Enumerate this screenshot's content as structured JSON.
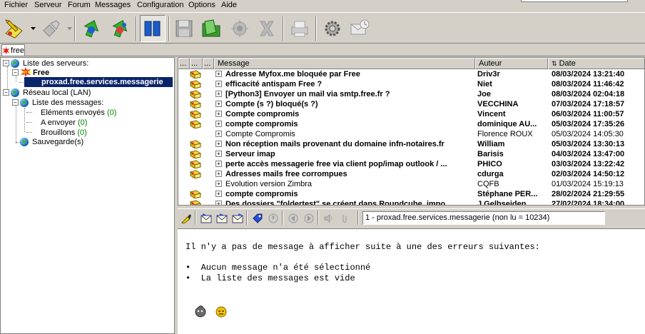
{
  "menu": {
    "fichier": "Fichier",
    "serveur": "Serveur",
    "forum": "Forum",
    "messages": "Messages",
    "configuration": "Configuration",
    "options": "Options",
    "aide": "Aide"
  },
  "account_tab": {
    "label": "free"
  },
  "tree": {
    "server_list": "Liste des serveurs:",
    "free": "Free",
    "mailbox": "proxad.free.services.messagerie",
    "lan": "Réseau local (LAN)",
    "message_list": "Liste des messages:",
    "sent": {
      "label": "Eléments envoyés",
      "count": "(0)"
    },
    "outbox": {
      "label": "A envoyer",
      "count": "(0)"
    },
    "drafts": {
      "label": "Brouillons",
      "count": "(0)"
    },
    "backup": "Sauvegarde(s)"
  },
  "list_header": {
    "col1": "...",
    "col2": "...",
    "col3": "...",
    "message": "Message",
    "author": "Auteur",
    "date": "Date"
  },
  "messages": [
    {
      "subject": "Adresse Myfox.me bloquée par Free",
      "author": "Driv3r",
      "date": "08/03/2024 13:21:40",
      "unread": true
    },
    {
      "subject": "efficacité antispam Free ?",
      "author": "Niet",
      "date": "08/03/2024 11:46:42",
      "unread": true
    },
    {
      "subject": "[Python3] Envoyer un mail via smtp.free.fr ?",
      "author": "Joe",
      "date": "08/03/2024 02:04:18",
      "unread": true
    },
    {
      "subject": "Compte (s ?) bloqué(s ?)",
      "author": "VECCHINA",
      "date": "07/03/2024 17:18:57",
      "unread": true
    },
    {
      "subject": "Compte compromis",
      "author": "Vincent",
      "date": "06/03/2024 11:00:57",
      "unread": true
    },
    {
      "subject": "compte compromis",
      "author": "dominique AU...",
      "date": "05/03/2024 17:35:26",
      "unread": true
    },
    {
      "subject": "Compte Compromis",
      "author": "Florence ROUX",
      "date": "05/03/2024 14:05:30",
      "unread": false
    },
    {
      "subject": "Non réception mails provenant du domaine infn-notaires.fr",
      "author": "William",
      "date": "05/03/2024 13:30:13",
      "unread": true
    },
    {
      "subject": "Serveur imap",
      "author": "Barisis",
      "date": "04/03/2024 13:47:00",
      "unread": true
    },
    {
      "subject": "perte accès messagerie free via client pop/imap outlook / ...",
      "author": "PHICO",
      "date": "03/03/2024 13:22:42",
      "unread": true
    },
    {
      "subject": "Adresses mails free corrompues",
      "author": "cdurga",
      "date": "02/03/2024 14:50:12",
      "unread": true
    },
    {
      "subject": "Evolution version Zimbra",
      "author": "CQFB",
      "date": "01/03/2024 15:19:13",
      "unread": false
    },
    {
      "subject": "compte compromis",
      "author": "Stéphane PER...",
      "date": "28/02/2024 21:29:55",
      "unread": true
    },
    {
      "subject": "Des dossiers \"foldertest\" se créent dans Roundcube, impo...",
      "author": "J.Gelbseiden",
      "date": "27/02/2024 18:34:00",
      "unread": true
    }
  ],
  "reader": {
    "info": "1 - proxad.free.services.messagerie (non lu = 10234)",
    "line1": "Il n'y a pas de message à afficher suite à une des erreurs suivantes:",
    "bullet1": "•  Aucun message n'a été sélectionné",
    "bullet2": "•  La liste des messages est vide"
  },
  "colors": {
    "face": "#d4d0c8",
    "selection": "#0a246a",
    "count_green": "#008000"
  }
}
